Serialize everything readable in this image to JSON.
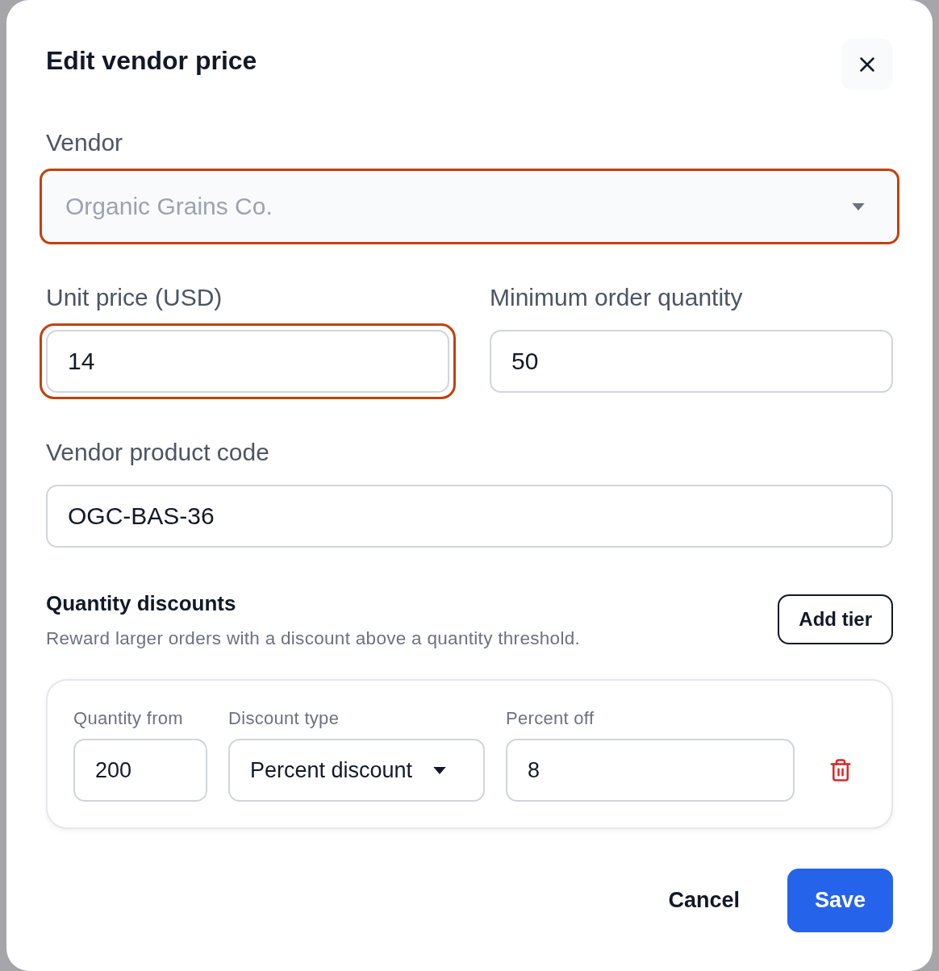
{
  "dialog": {
    "title": "Edit vendor price"
  },
  "form_rows": [
    {
      "fields": [
        {
          "kind": "select",
          "label": "Vendor",
          "value": "Organic Grains Co.",
          "disabled": true,
          "focused": true
        }
      ]
    },
    {
      "fields": [
        {
          "kind": "input",
          "label": "Unit price (USD)",
          "value": "14",
          "disabled": false,
          "focused": true
        },
        {
          "kind": "input",
          "label": "Minimum order quantity",
          "value": "50",
          "disabled": false,
          "focused": false
        }
      ]
    },
    {
      "fields": [
        {
          "kind": "input",
          "label": "Vendor product code",
          "value": "OGC-BAS-36",
          "disabled": false,
          "focused": false
        }
      ]
    }
  ],
  "quantity_discounts": {
    "title": "Quantity discounts",
    "description": "Reward larger orders with a discount above a quantity threshold.",
    "add_button": "Add tier",
    "tiers": [
      {
        "fields": [
          {
            "kind": "input",
            "label": "Quantity from",
            "value": "200"
          },
          {
            "kind": "select",
            "label": "Discount type",
            "value": "Percent discount"
          },
          {
            "kind": "input",
            "label": "Percent off",
            "value": "8"
          }
        ]
      }
    ]
  },
  "footer": {
    "buttons": [
      {
        "kind": "secondary",
        "label": "Cancel"
      },
      {
        "kind": "primary",
        "label": "Save"
      }
    ]
  }
}
